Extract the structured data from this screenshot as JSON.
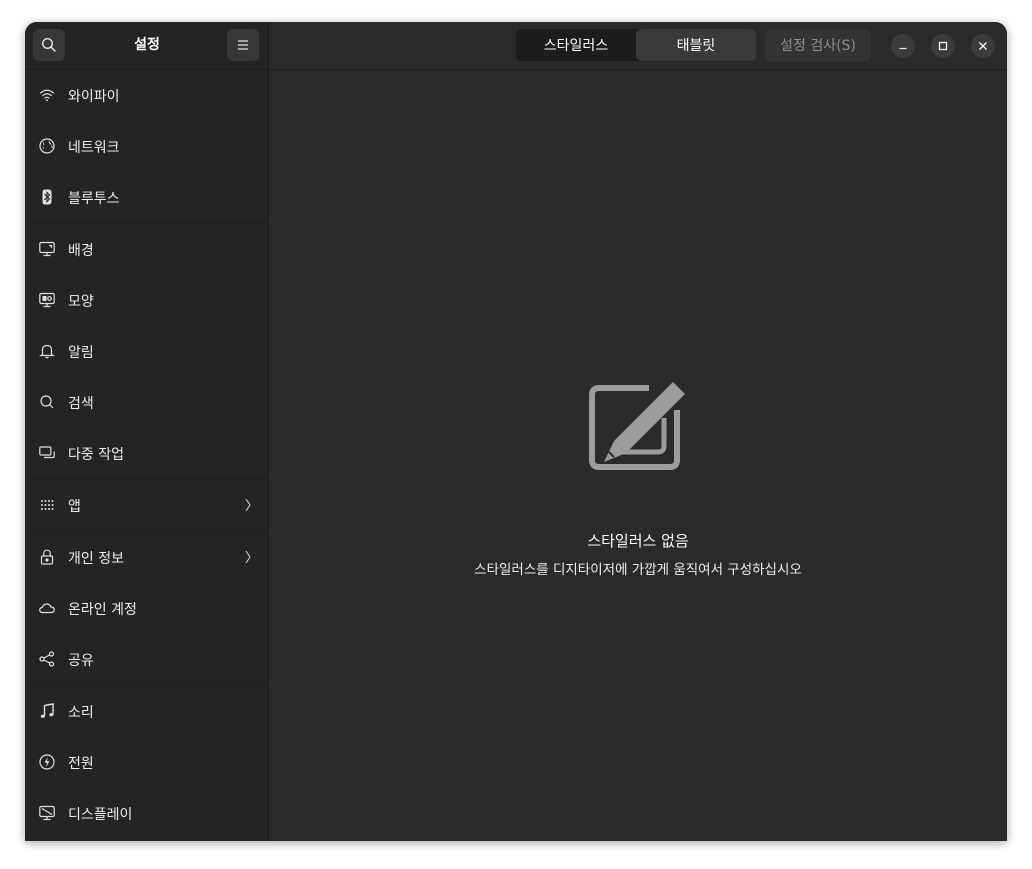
{
  "sidebar": {
    "title": "설정",
    "search_icon": "search-icon",
    "menu_icon": "menu-icon",
    "items": [
      {
        "label": "와이파이",
        "icon": "wifi-icon"
      },
      {
        "label": "네트워크",
        "icon": "globe-icon"
      },
      {
        "label": "블루투스",
        "icon": "bluetooth-icon"
      },
      {
        "label": "배경",
        "icon": "monitor-icon"
      },
      {
        "label": "모양",
        "icon": "appearance-icon"
      },
      {
        "label": "알림",
        "icon": "bell-icon"
      },
      {
        "label": "검색",
        "icon": "search-icon"
      },
      {
        "label": "다중 작업",
        "icon": "windows-icon"
      },
      {
        "label": "앱",
        "icon": "apps-grid-icon"
      },
      {
        "label": "개인 정보",
        "icon": "lock-icon"
      },
      {
        "label": "온라인 계정",
        "icon": "cloud-icon"
      },
      {
        "label": "공유",
        "icon": "share-icon"
      },
      {
        "label": "소리",
        "icon": "music-note-icon"
      },
      {
        "label": "전원",
        "icon": "power-icon"
      },
      {
        "label": "디스플레이",
        "icon": "display-icon"
      }
    ]
  },
  "header": {
    "tabs": [
      {
        "label": "스타일러스",
        "active": true
      },
      {
        "label": "태블릿",
        "active": false
      }
    ],
    "test_button": "설정 검사(S)"
  },
  "empty_state": {
    "icon": "stylus-pen-icon",
    "title": "스타일러스 없음",
    "subtitle": "스타일러스를 디지타이저에 가깝게 움직여서 구성하십시오"
  },
  "colors": {
    "window_bg": "#2a2a2a",
    "sidebar_bg": "#242424",
    "text": "#ededed",
    "muted": "#8d8d8d"
  }
}
